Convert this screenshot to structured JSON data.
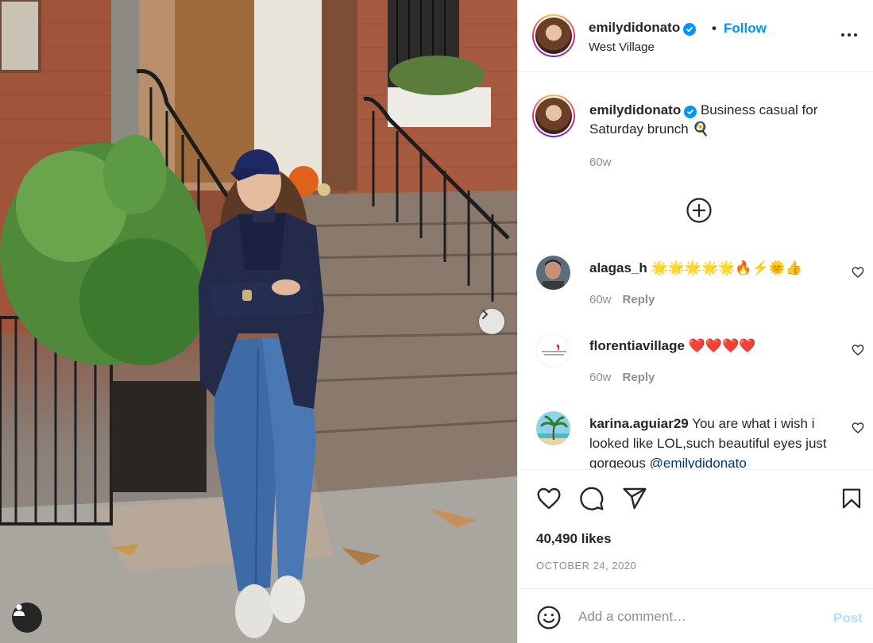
{
  "post": {
    "username": "emilydidonato",
    "verified": true,
    "separator": "•",
    "follow_label": "Follow",
    "location": "West Village",
    "image_alt": "Woman in navy cap, navy blazer and jeans leaning on a West Village stoop railing"
  },
  "caption": {
    "username": "emilydidonato",
    "text": "Business casual for Saturday brunch 🍳",
    "time": "60w"
  },
  "comments": [
    {
      "username": "alagas_h",
      "text": "🌟🌟🌟🌟🌟🔥⚡🌞👍",
      "time": "60w",
      "reply_label": "Reply",
      "avatar": "person-photo"
    },
    {
      "username": "florentiavillage",
      "text": "❤️❤️❤️❤️",
      "time": "60w",
      "reply_label": "Reply",
      "avatar": "florentia-village-logo"
    },
    {
      "username": "karina.aguiar29",
      "text": "You are what i wish i looked like LOL,such beautiful eyes just gorgeous",
      "mention": "@emilydidonato",
      "avatar": "palm-tree-photo"
    }
  ],
  "stats": {
    "likes": "40,490 likes",
    "date": "OCTOBER 24, 2020"
  },
  "composer": {
    "placeholder": "Add a comment…",
    "post_label": "Post"
  },
  "colors": {
    "accent": "#0095f6",
    "muted": "#8e8e8e",
    "text": "#262626",
    "post_disabled": "#b2dffc",
    "mention": "#00376b"
  },
  "icons": [
    "more-icon",
    "verified-icon",
    "load-more-icon",
    "heart-icon",
    "comment-icon",
    "share-icon",
    "bookmark-icon",
    "emoji-icon",
    "chevron-right-icon",
    "user-tag-icon"
  ]
}
